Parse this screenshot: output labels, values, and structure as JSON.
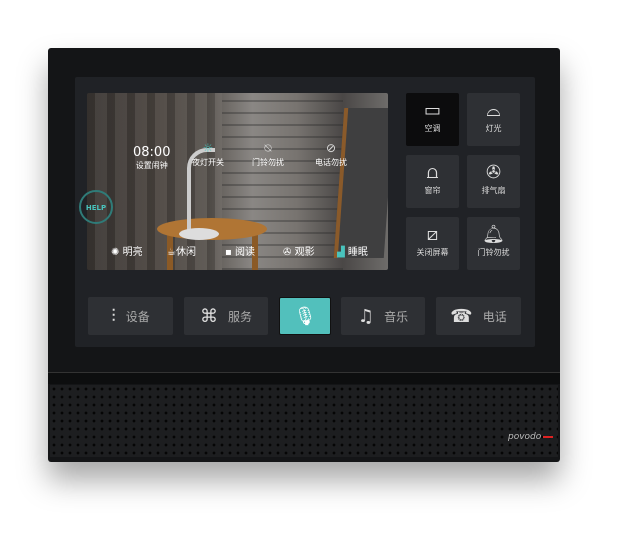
{
  "alarm": {
    "time": "08:00",
    "label": "设置闹钟"
  },
  "quick_toggles": [
    {
      "label": "夜灯开关",
      "icon": "night-light-icon"
    },
    {
      "label": "门铃勿扰",
      "icon": "bell-off-icon"
    },
    {
      "label": "电话勿扰",
      "icon": "phone-off-icon"
    }
  ],
  "help": {
    "label": "HELP"
  },
  "modes": [
    {
      "label": "明亮",
      "icon": "bulb-icon"
    },
    {
      "label": "休闲",
      "icon": "cup-icon"
    },
    {
      "label": "阅读",
      "icon": "book-icon"
    },
    {
      "label": "观影",
      "icon": "film-icon"
    },
    {
      "label": "睡眠",
      "icon": "bed-icon"
    }
  ],
  "devices": [
    {
      "label": "空调",
      "icon": "air-conditioner-icon",
      "active": true
    },
    {
      "label": "灯光",
      "icon": "ceiling-lamp-icon"
    },
    {
      "label": "窗帘",
      "icon": "curtain-icon"
    },
    {
      "label": "排气扇",
      "icon": "fan-icon"
    },
    {
      "label": "关闭屏幕",
      "icon": "screen-off-icon"
    },
    {
      "label": "门铃勿扰",
      "icon": "bell-icon"
    }
  ],
  "nav": [
    {
      "label": "设备",
      "icon": "sliders-icon"
    },
    {
      "label": "服务",
      "icon": "clover-icon"
    },
    {
      "label": "",
      "icon": "microphone-icon"
    },
    {
      "label": "音乐",
      "icon": "music-note-icon"
    },
    {
      "label": "电话",
      "icon": "telephone-icon"
    }
  ],
  "brand": "povodo",
  "colors": {
    "accent": "#52c0bc",
    "brand_red": "#dd2222"
  }
}
